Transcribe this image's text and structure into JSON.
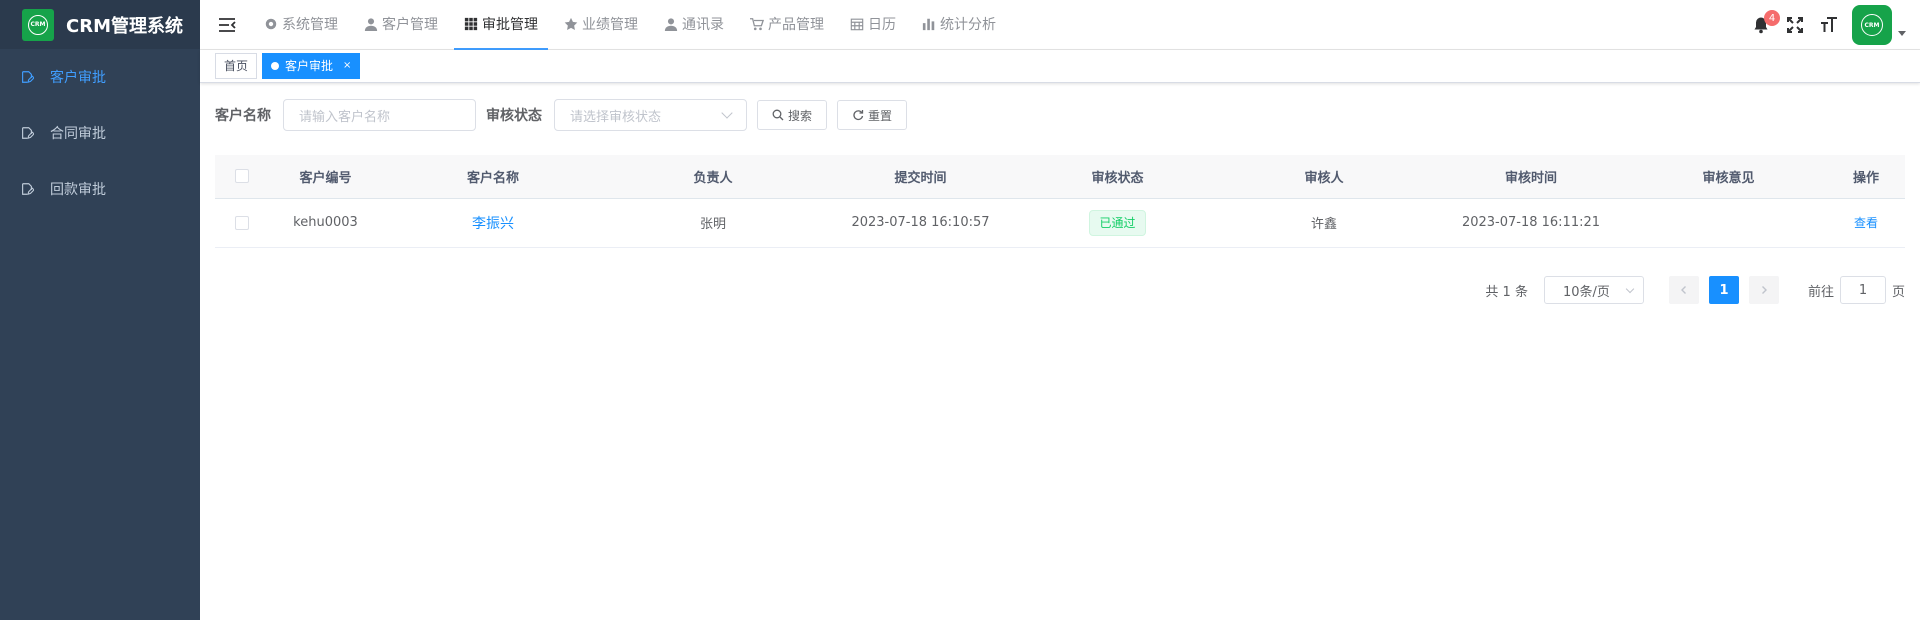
{
  "app": {
    "logo_text": "CRM",
    "title": "CRM管理系统"
  },
  "sidebar": {
    "items": [
      {
        "label": "客户审批",
        "icon": "edit-doc-icon",
        "active": true
      },
      {
        "label": "合同审批",
        "icon": "edit-doc-icon",
        "active": false
      },
      {
        "label": "回款审批",
        "icon": "edit-doc-icon",
        "active": false
      }
    ]
  },
  "topnav": {
    "items": [
      {
        "label": "系统管理",
        "icon": "gear-icon"
      },
      {
        "label": "客户管理",
        "icon": "user-icon"
      },
      {
        "label": "审批管理",
        "icon": "grid-icon",
        "active": true
      },
      {
        "label": "业绩管理",
        "icon": "star-icon"
      },
      {
        "label": "通讯录",
        "icon": "user-icon"
      },
      {
        "label": "产品管理",
        "icon": "cart-icon"
      },
      {
        "label": "日历",
        "icon": "calendar-icon"
      },
      {
        "label": "统计分析",
        "icon": "bar-chart-icon"
      }
    ]
  },
  "header": {
    "notification_count": "4",
    "avatar_text": "CRM"
  },
  "tags": {
    "home": "首页",
    "current": "客户审批",
    "close": "×"
  },
  "search": {
    "customer_name_label": "客户名称",
    "customer_name_placeholder": "请输入客户名称",
    "status_label": "审核状态",
    "status_placeholder": "请选择审核状态",
    "search_button": "搜索",
    "reset_button": "重置"
  },
  "table": {
    "headers": [
      "客户编号",
      "客户名称",
      "负责人",
      "提交时间",
      "审核状态",
      "审核人",
      "审核时间",
      "审核意见",
      "操作"
    ],
    "rows": [
      {
        "code": "kehu0003",
        "name": "李振兴",
        "owner": "张明",
        "submit_time": "2023-07-18 16:10:57",
        "status": "已通过",
        "auditor": "许鑫",
        "audit_time": "2023-07-18 16:11:21",
        "opinion": "",
        "action": "查看"
      }
    ]
  },
  "pagination": {
    "total": "共 1 条",
    "page_size": "10条/页",
    "current_page": "1",
    "goto_label": "前往",
    "goto_value": "1",
    "page_suffix": "页"
  },
  "colors": {
    "sidebar_bg": "#304156",
    "primary": "#1890ff",
    "brand_green": "#16a34a",
    "success": "#13ce66"
  }
}
